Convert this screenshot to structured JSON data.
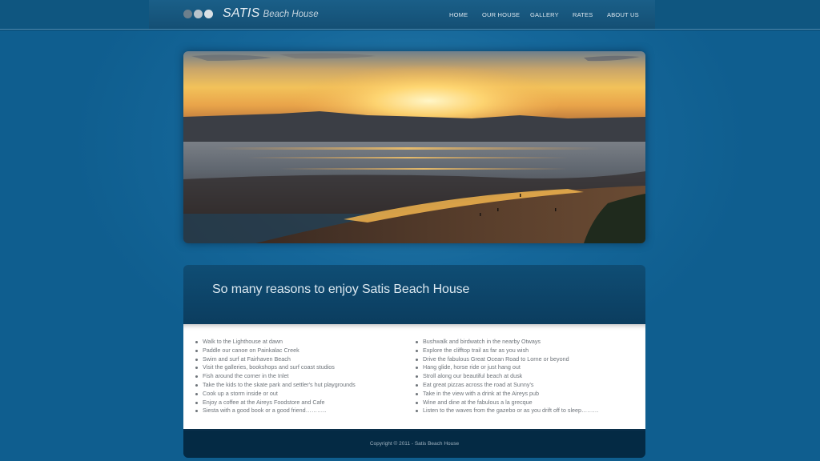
{
  "header": {
    "logo_main": "SATIS",
    "logo_sub": "Beach House",
    "dot_colors": [
      "#6d7f8c",
      "#b9c4cc",
      "#d9e0e5"
    ],
    "nav": [
      {
        "label": "HOME"
      },
      {
        "label": "OUR HOUSE"
      },
      {
        "label": "GALLERY"
      },
      {
        "label": "RATES"
      },
      {
        "label": "ABOUT US"
      }
    ]
  },
  "hero": {
    "image": "sunset-beach-photo"
  },
  "content": {
    "title": "So many reasons to enjoy Satis Beach House",
    "left_list": [
      "Walk to the Lighthouse at dawn",
      "Paddle our canoe on Painkalac Creek",
      "Swim and surf at Fairhaven Beach",
      "Visit the galleries, bookshops and surf coast studios",
      "Fish around the corner in the Inlet",
      "Take the kids to the skate park and settler's hut playgrounds",
      "Cook up a storm inside or out",
      "Enjoy a coffee at the Aireys Foodstore and Cafe",
      "Siesta with a good book or a good friend……….."
    ],
    "right_list": [
      "Bushwalk and birdwatch in the nearby Otways",
      "Explore the clifftop trail as far as you wish",
      "Drive the fabulous Great Ocean Road to Lorne or beyond",
      "Hang glide, horse ride or just hang out",
      "Stroll along our beautiful beach at dusk",
      "Eat great pizzas across the road at Sunny's",
      "Take in the view with a drink at the Aireys pub",
      "Wine and dine at the fabulous a la grecque",
      "Listen to the waves from the gazebo or as you drift off to sleep………"
    ]
  },
  "footer": {
    "copyright": "Copyright © 2011 - Satis Beach House"
  }
}
